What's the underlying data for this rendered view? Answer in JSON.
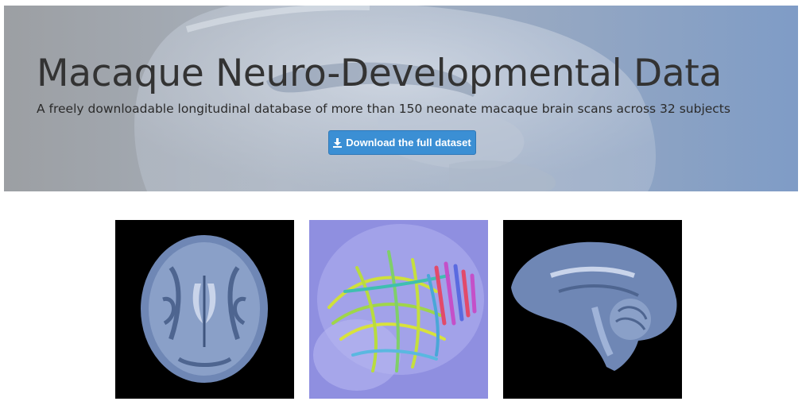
{
  "hero": {
    "title": "Macaque Neuro-Developmental Data",
    "subtitle": "A freely downloadable longitudinal database of more than 150 neonate macaque brain scans across 32 subjects",
    "download_button": {
      "label": "Download the full dataset",
      "icon": "download-icon"
    }
  },
  "gallery": [
    {
      "name": "axial-brain-scan-thumbnail",
      "background": "#000000"
    },
    {
      "name": "tractography-thumbnail",
      "background": "#8f8fe0"
    },
    {
      "name": "sagittal-brain-scan-thumbnail",
      "background": "#000000"
    }
  ],
  "colors": {
    "button": "#3b8fd4",
    "hero_gradient_right": "#7f9cc6",
    "scan_tint": "#6f87b5"
  }
}
